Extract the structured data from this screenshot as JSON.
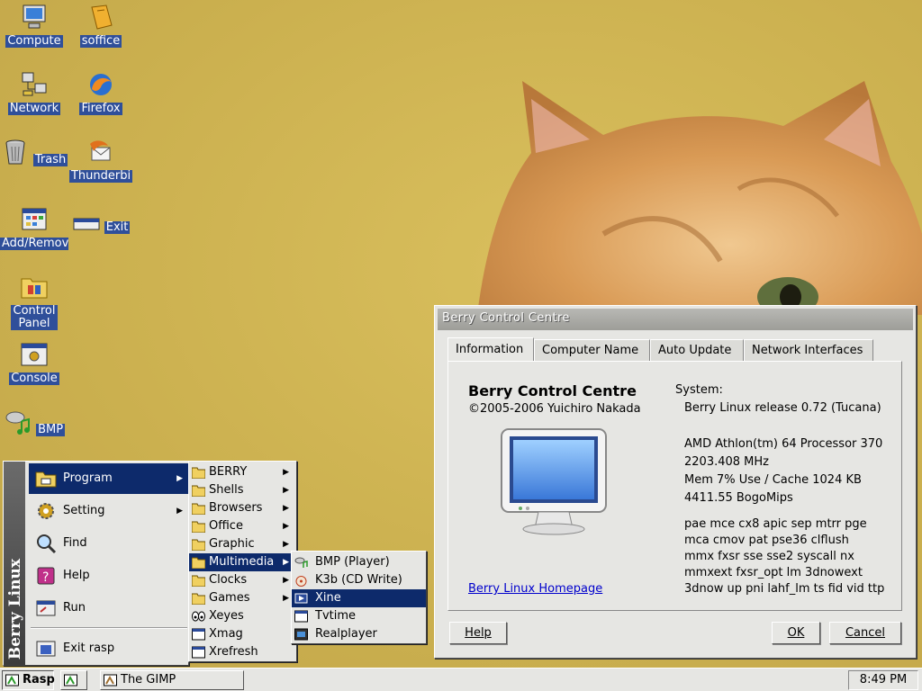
{
  "desktop": {
    "icons": [
      {
        "label": "Compute",
        "icon": "computer-icon"
      },
      {
        "label": "soffice",
        "icon": "soffice-icon"
      },
      {
        "label": "Network",
        "icon": "network-icon"
      },
      {
        "label": "Firefox",
        "icon": "firefox-icon"
      },
      {
        "label": "Trash",
        "icon": "trash-icon"
      },
      {
        "label": "Thunderbi",
        "icon": "thunderbird-icon"
      },
      {
        "label": "Add/Remov",
        "icon": "add-remove-icon"
      },
      {
        "label": "Exit",
        "icon": "exit-icon"
      },
      {
        "label": "Control Panel",
        "icon": "control-panel-icon"
      },
      {
        "label": "Console",
        "icon": "console-icon"
      },
      {
        "label": "BMP",
        "icon": "bmp-icon"
      }
    ]
  },
  "window": {
    "title": "Berry Control Centre",
    "tabs": [
      "Information",
      "Computer Name",
      "Auto Update",
      "Network Interfaces"
    ],
    "active_tab": "Information",
    "info": {
      "app_title": "Berry Control Centre",
      "copyright": "©2005-2006 Yuichiro Nakada",
      "homepage_link": "Berry Linux Homepage",
      "system_heading": "System:",
      "release": "Berry Linux release 0.72 (Tucana)",
      "cpu": "AMD Athlon(tm) 64 Processor 370",
      "mhz": "2203.408 MHz",
      "mem": "Mem 7% Use / Cache 1024 KB",
      "bogomips": "4411.55 BogoMips",
      "flags": [
        "pae mce cx8 apic sep mtrr pge",
        "mca cmov pat pse36 clflush",
        "mmx fxsr sse sse2 syscall nx",
        "mmxext fxsr_opt lm 3dnowext",
        "3dnow up pni lahf_lm ts fid vid ttp"
      ]
    },
    "buttons": {
      "help": "Help",
      "ok": "OK",
      "cancel": "Cancel"
    }
  },
  "start_menu": {
    "band_label": "Berry Linux",
    "items": [
      {
        "label": "Program",
        "submenu": true,
        "highlighted": true
      },
      {
        "label": "Setting",
        "submenu": true
      },
      {
        "label": "Find"
      },
      {
        "label": "Help"
      },
      {
        "label": "Run"
      },
      {
        "label": "Exit rasp"
      }
    ],
    "program_submenu": [
      {
        "label": "BERRY",
        "submenu": true
      },
      {
        "label": "Shells",
        "submenu": true
      },
      {
        "label": "Browsers",
        "submenu": true
      },
      {
        "label": "Office",
        "submenu": true
      },
      {
        "label": "Graphic",
        "submenu": true
      },
      {
        "label": "Multimedia",
        "submenu": true,
        "highlighted": true
      },
      {
        "label": "Clocks",
        "submenu": true
      },
      {
        "label": "Games",
        "submenu": true
      },
      {
        "label": "Xeyes"
      },
      {
        "label": "Xmag"
      },
      {
        "label": "Xrefresh"
      }
    ],
    "multimedia_submenu": [
      {
        "label": "BMP (Player)"
      },
      {
        "label": "K3b (CD Write)"
      },
      {
        "label": "Xine",
        "highlighted": true
      },
      {
        "label": "Tvtime"
      },
      {
        "label": "Realplayer"
      }
    ]
  },
  "taskbar": {
    "start_label": "Rasp",
    "tasks": [
      "The GIMP"
    ],
    "clock": "8:49 PM"
  }
}
